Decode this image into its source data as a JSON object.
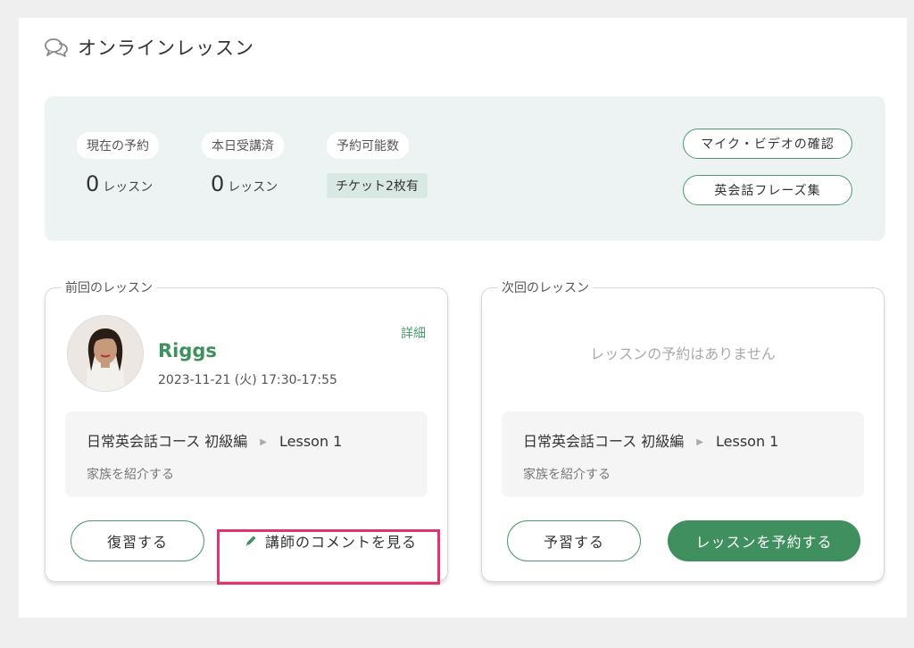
{
  "header": {
    "title": "オンラインレッスン",
    "icon": "chat-bubbles-icon"
  },
  "summary": {
    "current_reservations": {
      "label": "現在の予約",
      "value": "0",
      "unit": "レッスン"
    },
    "completed_today": {
      "label": "本日受講済",
      "value": "0",
      "unit": "レッスン"
    },
    "available": {
      "label": "予約可能数",
      "badge": "チケット2枚有"
    },
    "mic_video_button": "マイク・ビデオの確認",
    "phrases_button": "英会話フレーズ集"
  },
  "previous_lesson": {
    "legend": "前回のレッスン",
    "teacher": "Riggs",
    "datetime": "2023-11-21 (火) 17:30-17:55",
    "detail_link": "詳細",
    "course": "日常英会話コース 初級編",
    "lesson": "Lesson 1",
    "topic": "家族を紹介する",
    "review_button": "復習する",
    "comment_button": "講師のコメントを見る"
  },
  "next_lesson": {
    "legend": "次回のレッスン",
    "empty_message": "レッスンの予約はありません",
    "course": "日常英会話コース 初級編",
    "lesson": "Lesson 1",
    "topic": "家族を紹介する",
    "preview_button": "予習する",
    "book_button": "レッスンを予約する"
  },
  "colors": {
    "accent": "#3f8f5f",
    "highlight": "#e0336f",
    "summary_bg": "#edf3f2"
  }
}
